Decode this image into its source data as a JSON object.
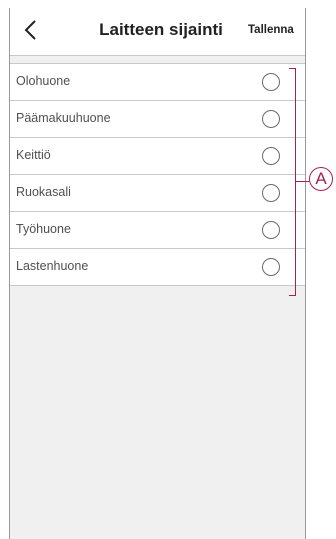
{
  "header": {
    "title": "Laitteen sijainti",
    "save_label": "Tallenna",
    "back_icon": "chevron-left-icon"
  },
  "rooms": [
    {
      "label": "Olohuone",
      "selected": false
    },
    {
      "label": "Päämakuuhuone",
      "selected": false
    },
    {
      "label": "Keittiö",
      "selected": false
    },
    {
      "label": "Ruokasali",
      "selected": false
    },
    {
      "label": "Työhuone",
      "selected": false
    },
    {
      "label": "Lastenhuone",
      "selected": false
    }
  ],
  "callout": {
    "marker": "A",
    "color": "#a8204e"
  }
}
